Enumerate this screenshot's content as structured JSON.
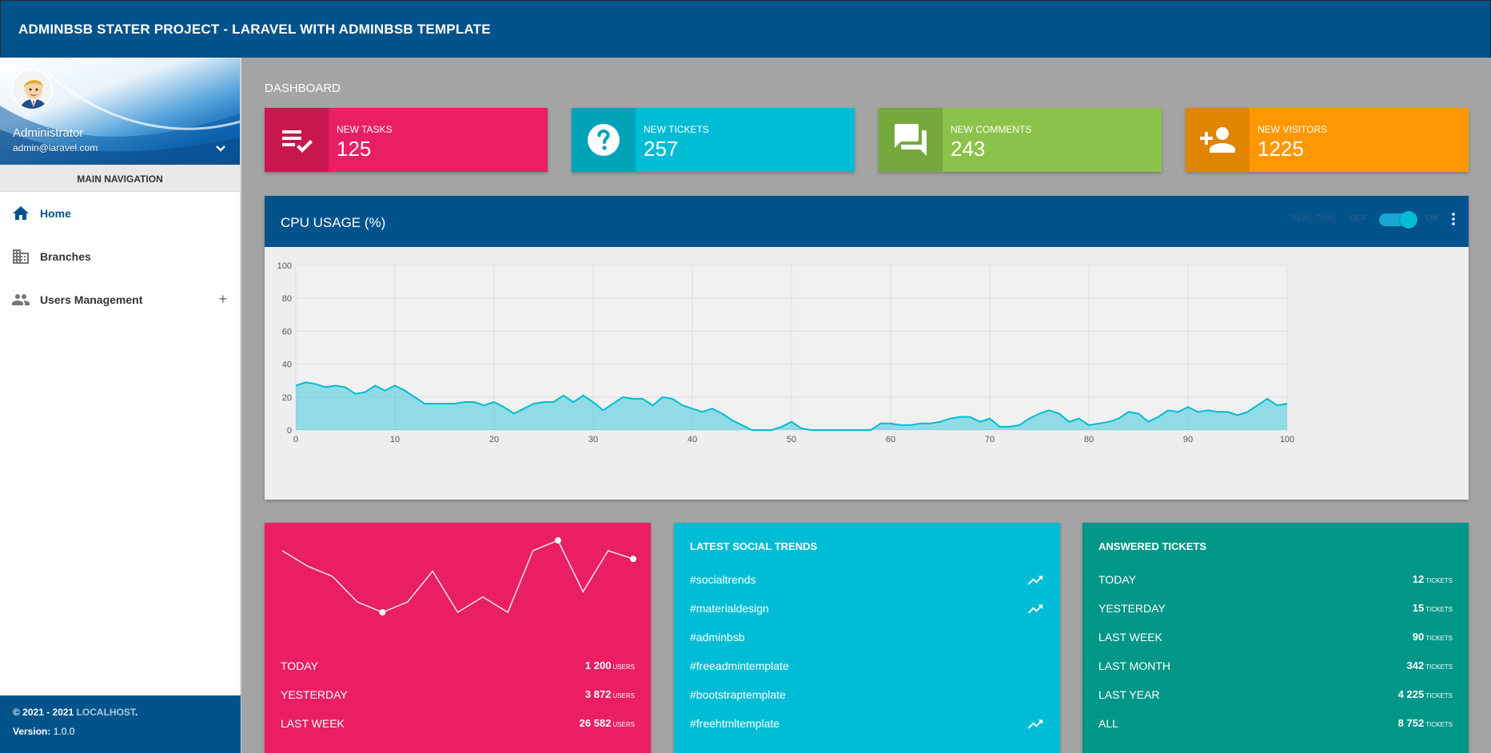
{
  "header": {
    "title": "ADMINBSB STATER PROJECT - LARAVEL WITH ADMINBSB TEMPLATE"
  },
  "user": {
    "name": "Administrator",
    "email": "admin@laravel.com"
  },
  "nav": {
    "header": "MAIN NAVIGATION",
    "items": [
      {
        "label": "Home",
        "icon": "home-icon",
        "active": true
      },
      {
        "label": "Branches",
        "icon": "building-icon"
      },
      {
        "label": "Users Management",
        "icon": "people-icon",
        "expand": "+"
      }
    ]
  },
  "footer": {
    "copyright": "© 2021 - 2021",
    "brand": "LOCALHOST",
    "brand_suffix": ".",
    "version_label": "Version:",
    "version": "1.0.0"
  },
  "page": {
    "title": "DASHBOARD"
  },
  "infoboxes": [
    {
      "label": "NEW TASKS",
      "value": "125",
      "color": "#e91e63",
      "icon_bg": "#c8174f",
      "icon": "playlist-check-icon"
    },
    {
      "label": "NEW TICKETS",
      "value": "257",
      "color": "#00bcd4",
      "icon_bg": "#00a2b8",
      "icon": "help-circle-icon"
    },
    {
      "label": "NEW COMMENTS",
      "value": "243",
      "color": "#8bc34a",
      "icon_bg": "#76a93d",
      "icon": "forum-icon"
    },
    {
      "label": "NEW VISITORS",
      "value": "1225",
      "color": "#ff9800",
      "icon_bg": "#e08500",
      "icon": "person-add-icon"
    }
  ],
  "cpu": {
    "title": "CPU USAGE (%)",
    "realtime_label": "REAL TIME",
    "off_label": "OFF",
    "on_label": "ON",
    "toggle_on": true
  },
  "chart_data": {
    "type": "area",
    "title": "CPU USAGE (%)",
    "xlim": [
      0,
      100
    ],
    "ylim": [
      0,
      100
    ],
    "x_ticks": [
      "0",
      "10",
      "20",
      "30",
      "40",
      "50",
      "60",
      "70",
      "80",
      "90",
      "100"
    ],
    "y_ticks": [
      "0",
      "20",
      "40",
      "60",
      "80",
      "100"
    ],
    "grid": true,
    "color": "#00bcd4",
    "values": [
      27,
      29,
      28,
      26,
      27,
      26,
      22,
      23,
      27,
      24,
      27,
      24,
      20,
      16,
      16,
      16,
      16,
      17,
      17,
      15,
      17,
      14,
      10,
      13,
      16,
      17,
      17,
      21,
      17,
      21,
      17,
      12,
      16,
      20,
      19,
      19,
      15,
      20,
      19,
      15,
      13,
      11,
      13,
      10,
      6,
      3,
      0,
      0,
      0,
      2,
      5,
      1,
      0,
      0,
      0,
      0,
      0,
      0,
      0,
      4,
      4,
      3,
      3,
      4,
      4,
      5,
      7,
      8,
      8,
      5,
      7,
      2,
      2,
      3,
      7,
      10,
      12,
      10,
      5,
      7,
      3,
      4,
      5,
      7,
      11,
      10,
      5,
      8,
      12,
      11,
      14,
      11,
      12,
      11,
      11,
      9,
      11,
      15,
      19,
      15,
      16
    ]
  },
  "sparkline": {
    "color": "#ffffff",
    "values": [
      10,
      8.5,
      7.5,
      5,
      4,
      5,
      8,
      4,
      5.5,
      4,
      10,
      11,
      6,
      10,
      9.2
    ],
    "highlight_points": [
      4,
      11,
      14
    ],
    "stats": [
      {
        "label": "TODAY",
        "value": "1 200",
        "unit": "USERS"
      },
      {
        "label": "YESTERDAY",
        "value": "3 872",
        "unit": "USERS"
      },
      {
        "label": "LAST WEEK",
        "value": "26 582",
        "unit": "USERS"
      }
    ]
  },
  "social": {
    "title": "LATEST SOCIAL TRENDS",
    "items": [
      {
        "tag": "#socialtrends",
        "trending": true
      },
      {
        "tag": "#materialdesign",
        "trending": true
      },
      {
        "tag": "#adminbsb",
        "trending": false
      },
      {
        "tag": "#freeadmintemplate",
        "trending": false
      },
      {
        "tag": "#bootstraptemplate",
        "trending": false
      },
      {
        "tag": "#freehtmltemplate",
        "trending": true
      }
    ]
  },
  "tickets": {
    "title": "ANSWERED TICKETS",
    "rows": [
      {
        "label": "TODAY",
        "value": "12",
        "unit": "TICKETS"
      },
      {
        "label": "YESTERDAY",
        "value": "15",
        "unit": "TICKETS"
      },
      {
        "label": "LAST WEEK",
        "value": "90",
        "unit": "TICKETS"
      },
      {
        "label": "LAST MONTH",
        "value": "342",
        "unit": "TICKETS"
      },
      {
        "label": "LAST YEAR",
        "value": "4 225",
        "unit": "TICKETS"
      },
      {
        "label": "ALL",
        "value": "8 752",
        "unit": "TICKETS"
      }
    ]
  },
  "colors": {
    "primary": "#02538c",
    "pink": "#e91e63",
    "cyan": "#00bcd4",
    "teal": "#009688",
    "green": "#8bc34a",
    "orange": "#ff9800"
  }
}
